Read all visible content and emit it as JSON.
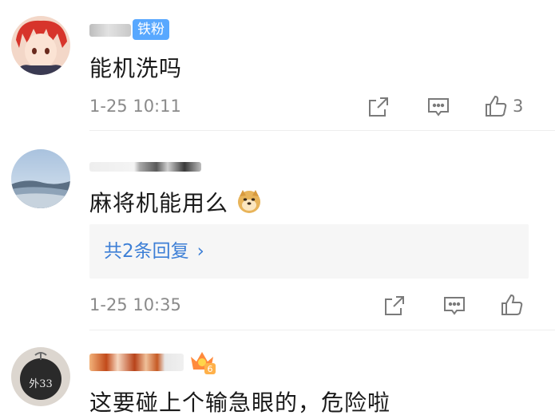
{
  "comments": [
    {
      "badge": "铁粉",
      "text": "能机洗吗",
      "time": "1-25 10:11",
      "likes": "3"
    },
    {
      "text": "麻将机能用么",
      "emoji": "doge-emoji",
      "time": "1-25 10:35",
      "replies_label": "共2条回复"
    },
    {
      "avatar_text": "外33",
      "vip_badge_level": "6",
      "text": "这要碰上个输急眼的，危险啦"
    }
  ],
  "colors": {
    "badge_bg": "#58a8ff",
    "reply_link": "#3d7fd6",
    "meta_gray": "#8a8a8a"
  }
}
